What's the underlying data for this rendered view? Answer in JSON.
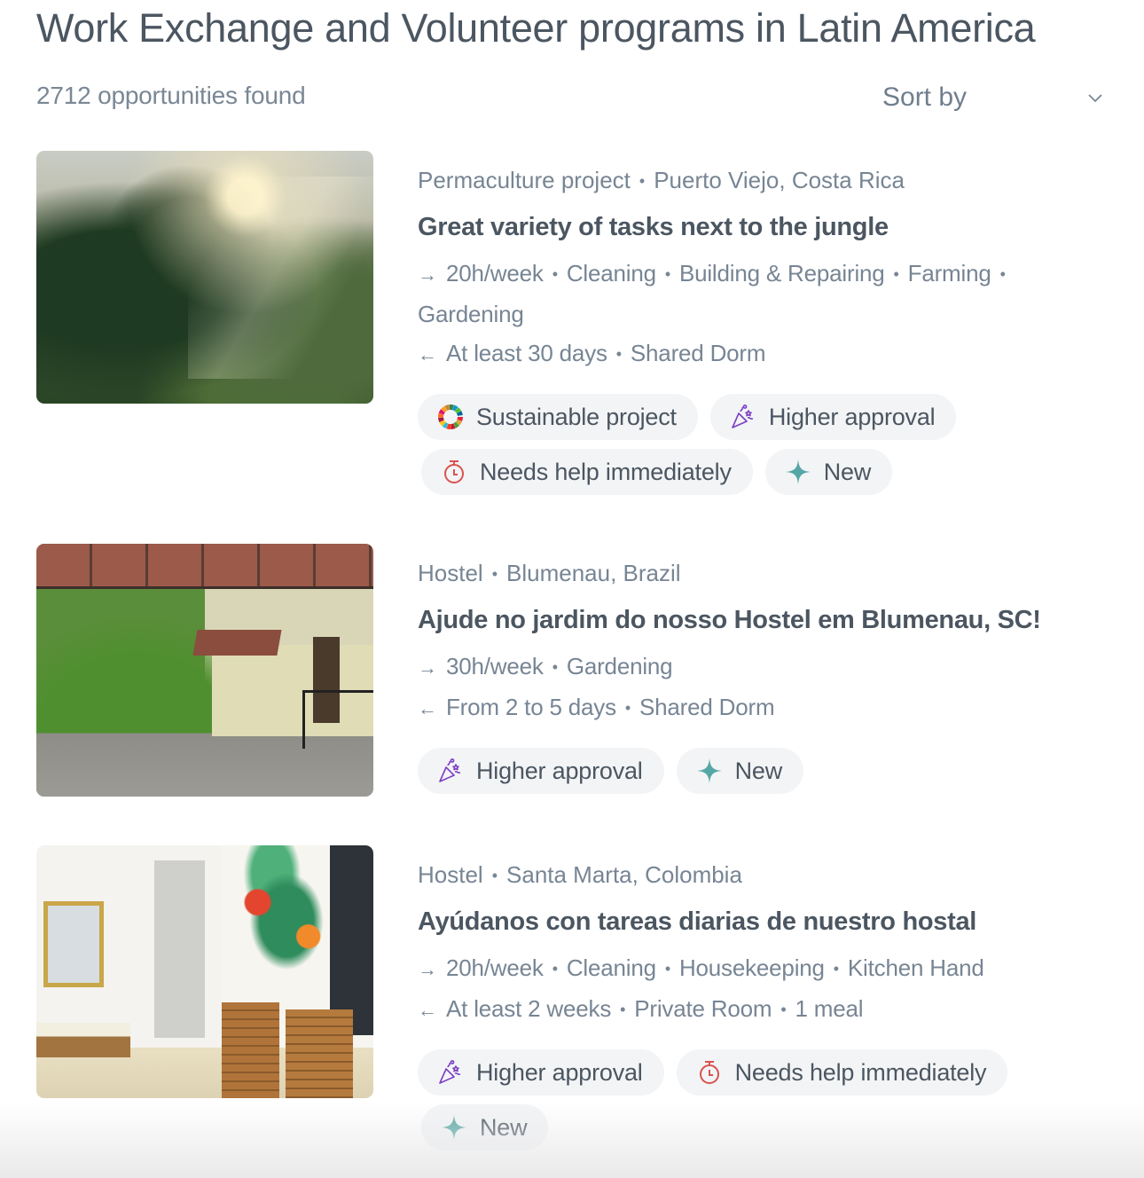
{
  "header": {
    "title": "Work Exchange and Volunteer programs in Latin America",
    "results_count": "2712 opportunities found",
    "sort": {
      "label": "Sort by",
      "icon": "chevron-down-icon"
    }
  },
  "listings": [
    {
      "image_alt": "Misty jungle at sunrise",
      "category": "Permaculture project",
      "location": "Puerto Viejo, Costa Rica",
      "title": "Great variety of tasks next to the jungle",
      "hours": "20h/week",
      "tasks": [
        "Cleaning",
        "Building & Repairing",
        "Farming",
        "Gardening"
      ],
      "duration": "At least 30 days",
      "perks": [
        "Shared Dorm"
      ],
      "tags": [
        {
          "label": "Sustainable project",
          "icon": "sdg-wheel-icon"
        },
        {
          "label": "Higher approval",
          "icon": "party-popper-icon"
        },
        {
          "label": "Needs help immediately",
          "icon": "stopwatch-icon"
        },
        {
          "label": "New",
          "icon": "sparkle-icon"
        }
      ]
    },
    {
      "image_alt": "Hostel garden with covered walkway",
      "category": "Hostel",
      "location": "Blumenau, Brazil",
      "title": "Ajude no jardim do nosso Hostel em Blumenau, SC!",
      "hours": "30h/week",
      "tasks": [
        "Gardening"
      ],
      "duration": "From 2 to 5 days",
      "perks": [
        "Shared Dorm"
      ],
      "tags": [
        {
          "label": "Higher approval",
          "icon": "party-popper-icon"
        },
        {
          "label": "New",
          "icon": "sparkle-icon"
        }
      ]
    },
    {
      "image_alt": "Hostel common room with tropical mural",
      "category": "Hostel",
      "location": "Santa Marta, Colombia",
      "title": "Ayúdanos con tareas diarias de nuestro hostal",
      "hours": "20h/week",
      "tasks": [
        "Cleaning",
        "Housekeeping",
        "Kitchen Hand"
      ],
      "duration": "At least 2 weeks",
      "perks": [
        "Private Room",
        "1 meal"
      ],
      "tags": [
        {
          "label": "Higher approval",
          "icon": "party-popper-icon"
        },
        {
          "label": "Needs help immediately",
          "icon": "stopwatch-icon"
        },
        {
          "label": "New",
          "icon": "sparkle-icon"
        }
      ]
    }
  ],
  "colors": {
    "title_text": "#4b5661",
    "muted_text": "#778594",
    "tag_background": "#f3f4f6",
    "sparkle_teal": "#55a7a5",
    "stopwatch_red": "#d9534f",
    "popper_purple": "#7b3fc4"
  }
}
